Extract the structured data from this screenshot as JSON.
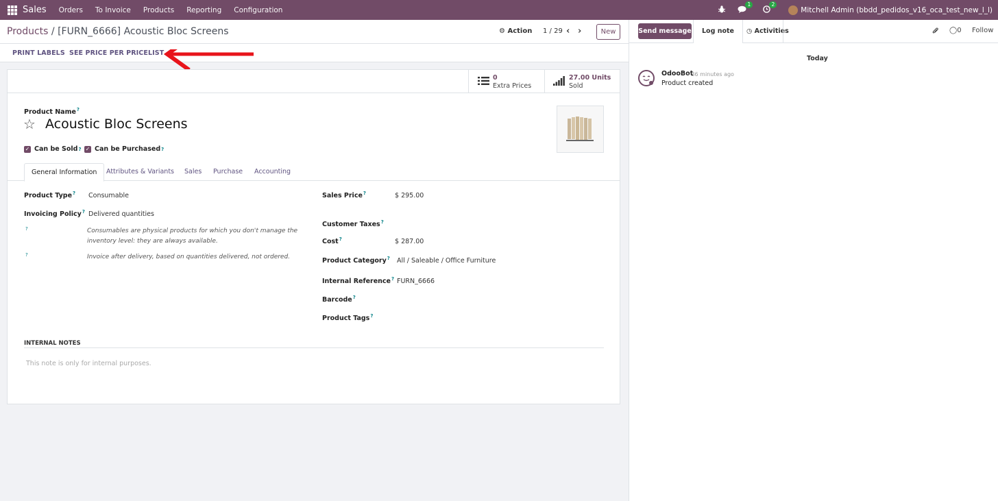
{
  "navbar": {
    "app_name": "Sales",
    "menu": [
      "Orders",
      "To Invoice",
      "Products",
      "Reporting",
      "Configuration"
    ],
    "messages_badge": "1",
    "activities_badge": "2",
    "user": "Mitchell Admin (bbdd_pedidos_v16_oca_test_new_l_l)"
  },
  "control": {
    "breadcrumb_root": "Products",
    "breadcrumb_sep": "/",
    "breadcrumb_current": "[FURN_6666] Acoustic Bloc Screens",
    "action": "Action",
    "pager": "1 / 29",
    "new": "New"
  },
  "header_buttons": {
    "print_labels": "PRINT LABELS",
    "price_per_pricelist": "SEE PRICE PER PRICELIST"
  },
  "stat_buttons": {
    "extra_prices_value": "0",
    "extra_prices_label": "Extra Prices",
    "sold_value": "27.00 Units",
    "sold_label": "Sold"
  },
  "form": {
    "product_name_label": "Product Name",
    "product_name": "Acoustic Bloc Screens",
    "can_be_sold": "Can be Sold",
    "can_be_purchased": "Can be Purchased",
    "tabs": [
      "General Information",
      "Attributes & Variants",
      "Sales",
      "Purchase",
      "Accounting"
    ],
    "left": {
      "product_type_label": "Product Type",
      "product_type": "Consumable",
      "invoicing_policy_label": "Invoicing Policy",
      "invoicing_policy": "Delivered quantities",
      "help_consumable_1": "Consumables are physical products for which you don't manage the",
      "help_consumable_2": "inventory level: they are always available.",
      "help_invoice": "Invoice after delivery, based on quantities delivered, not ordered."
    },
    "right": {
      "sales_price_label": "Sales Price",
      "sales_price": "$ 295.00",
      "customer_taxes_label": "Customer Taxes",
      "cost_label": "Cost",
      "cost": "$ 287.00",
      "category_label": "Product Category",
      "category": "All / Saleable / Office Furniture",
      "internal_ref_label": "Internal Reference",
      "internal_ref": "FURN_6666",
      "barcode_label": "Barcode",
      "tags_label": "Product Tags"
    },
    "notes_heading": "INTERNAL NOTES",
    "notes_placeholder": "This note is only for internal purposes."
  },
  "chatter": {
    "send_message": "Send message",
    "log_note": "Log note",
    "activities": "Activities",
    "followers_count": "0",
    "follow": "Follow",
    "date_separator": "Today",
    "author": "OdooBot",
    "time": "- 36 minutes ago",
    "message": "Product created"
  },
  "colors": {
    "brand": "#714b67",
    "annotation_arrow": "#e8141b"
  }
}
